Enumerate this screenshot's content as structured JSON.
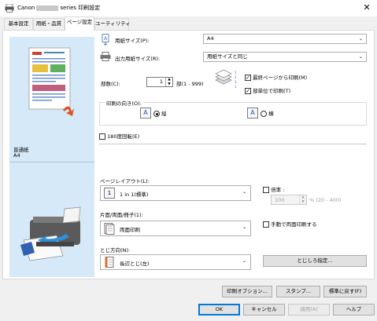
{
  "window": {
    "title_prefix": "Canon",
    "title_suffix": "series 印刷設定",
    "close_glyph": "✕"
  },
  "tabs": [
    {
      "label": "基本設定"
    },
    {
      "label": "用紙・品質"
    },
    {
      "label": "ページ設定"
    },
    {
      "label": "ユーティリティ"
    }
  ],
  "preview": {
    "media_type": "普通紙",
    "paper_size": "A4"
  },
  "page_size": {
    "label": "用紙サイズ(P):",
    "value": "A4"
  },
  "output_size": {
    "label": "出力用紙サイズ(R):",
    "value": "用紙サイズと同じ"
  },
  "copies": {
    "label": "部数(C):",
    "value": "1",
    "range": "部(1 - 999)"
  },
  "print_from_last": {
    "label": "最終ページから印刷(M)",
    "checked": true
  },
  "collate": {
    "label": "部単位で印刷(T)",
    "checked": true
  },
  "orientation": {
    "legend": "印刷の向き(O):",
    "portrait_icon": "A",
    "portrait": "縦",
    "landscape_icon": "A",
    "landscape": "横"
  },
  "rotate180": {
    "label": "180度回転(E)",
    "checked": false
  },
  "page_layout": {
    "label": "ページレイアウト(L):",
    "icon_text": "1",
    "value": "1 in 1(標準)"
  },
  "scaling": {
    "label": "倍率 :",
    "value": "100",
    "range": "% (20 - 400)"
  },
  "duplex": {
    "label": "片面/両面/冊子(1):",
    "value": "両面印刷"
  },
  "manual_duplex": {
    "label": "手動で両面印刷する"
  },
  "binding": {
    "label": "とじ方向(N):",
    "value": "長辺とじ(左)"
  },
  "margin_button": "とじしろ指定...",
  "lower_buttons": {
    "print_options": "印刷オプション...",
    "stamp": "スタンプ...",
    "defaults": "標準に戻す(F)"
  },
  "dialog_buttons": {
    "ok": "OK",
    "cancel": "キャンセル",
    "apply": "適用(A)",
    "help": "ヘルプ"
  },
  "colors": {
    "accent": "#0078d7",
    "preview_bg": "#d6e9f8"
  }
}
